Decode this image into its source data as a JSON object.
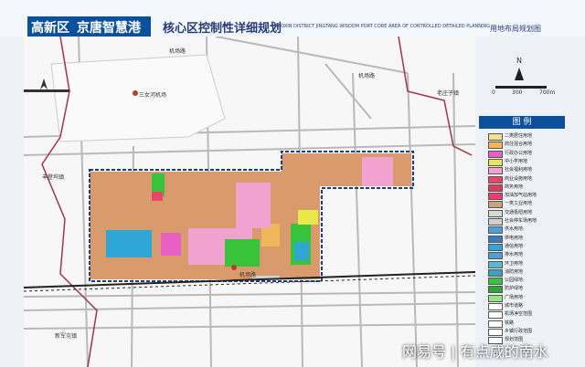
{
  "header": {
    "region": "高新区",
    "port": "京唐智慧港",
    "plan_title": "核心区控制性详细规划",
    "plan_title_en": "GAOXIN DISTRICT JINGTANG WISDOM PORT CORE AREA OF CONTROLLED DETAILED PLANNING",
    "drawing_title": "用地布局规划图"
  },
  "map_labels": {
    "airport": "三女河机场",
    "road_airport_1": "机场路",
    "road_airport_2": "机场路",
    "village_laozhuang": "老庄子镇",
    "village_fengdeng": "丰登坞镇",
    "village_xinjun": "新军屯镇",
    "airport_road_station": "机场路",
    "road_tangfeng": "唐丰路"
  },
  "scale": {
    "n": "N",
    "zero": "0",
    "mid": "300",
    "end": "700m"
  },
  "legend": {
    "title": "图  例",
    "items": [
      {
        "label": "二类居住用地",
        "color": "#f4e28a"
      },
      {
        "label": "商住混合用地",
        "color": "#f0b85a"
      },
      {
        "label": "行政办公用地",
        "color": "#e860c6"
      },
      {
        "label": "中小学用地",
        "color": "#e8e84a"
      },
      {
        "label": "社会福利用地",
        "color": "#f2a2cf"
      },
      {
        "label": "商业设施用地",
        "color": "#e9446c"
      },
      {
        "label": "商务用地",
        "color": "#e23a5a"
      },
      {
        "label": "加油加气站用地",
        "color": "#ee3b6e"
      },
      {
        "label": "一类工业用地",
        "color": "#c9a37c"
      },
      {
        "label": "交通枢纽用地",
        "color": "#d8d8d8"
      },
      {
        "label": "社会停车场用地",
        "color": "#d0d0d0"
      },
      {
        "label": "供水用地",
        "color": "#4aa0d8"
      },
      {
        "label": "供电用地",
        "color": "#3c7bbf"
      },
      {
        "label": "通信用地",
        "color": "#2ea7d6"
      },
      {
        "label": "排水用地",
        "color": "#4f9fd0"
      },
      {
        "label": "环卫用地",
        "color": "#58b7d6"
      },
      {
        "label": "消防用地",
        "color": "#3ea0c0"
      },
      {
        "label": "公园绿地",
        "color": "#37c43a"
      },
      {
        "label": "防护绿地",
        "color": "#2ca72f"
      },
      {
        "label": "广场用地",
        "color": "#8fe87a"
      },
      {
        "label": "城市道路",
        "color": "#ffffff"
      },
      {
        "label": "机场净空范围",
        "color": "#ffffff"
      },
      {
        "label": "铁路",
        "color": "#ffffff"
      },
      {
        "label": "乡镇行政范围",
        "color": "#ffffff"
      },
      {
        "label": "规划范围",
        "color": "#ffffff"
      }
    ]
  },
  "watermark": "网易号 | 有点咸的南水"
}
